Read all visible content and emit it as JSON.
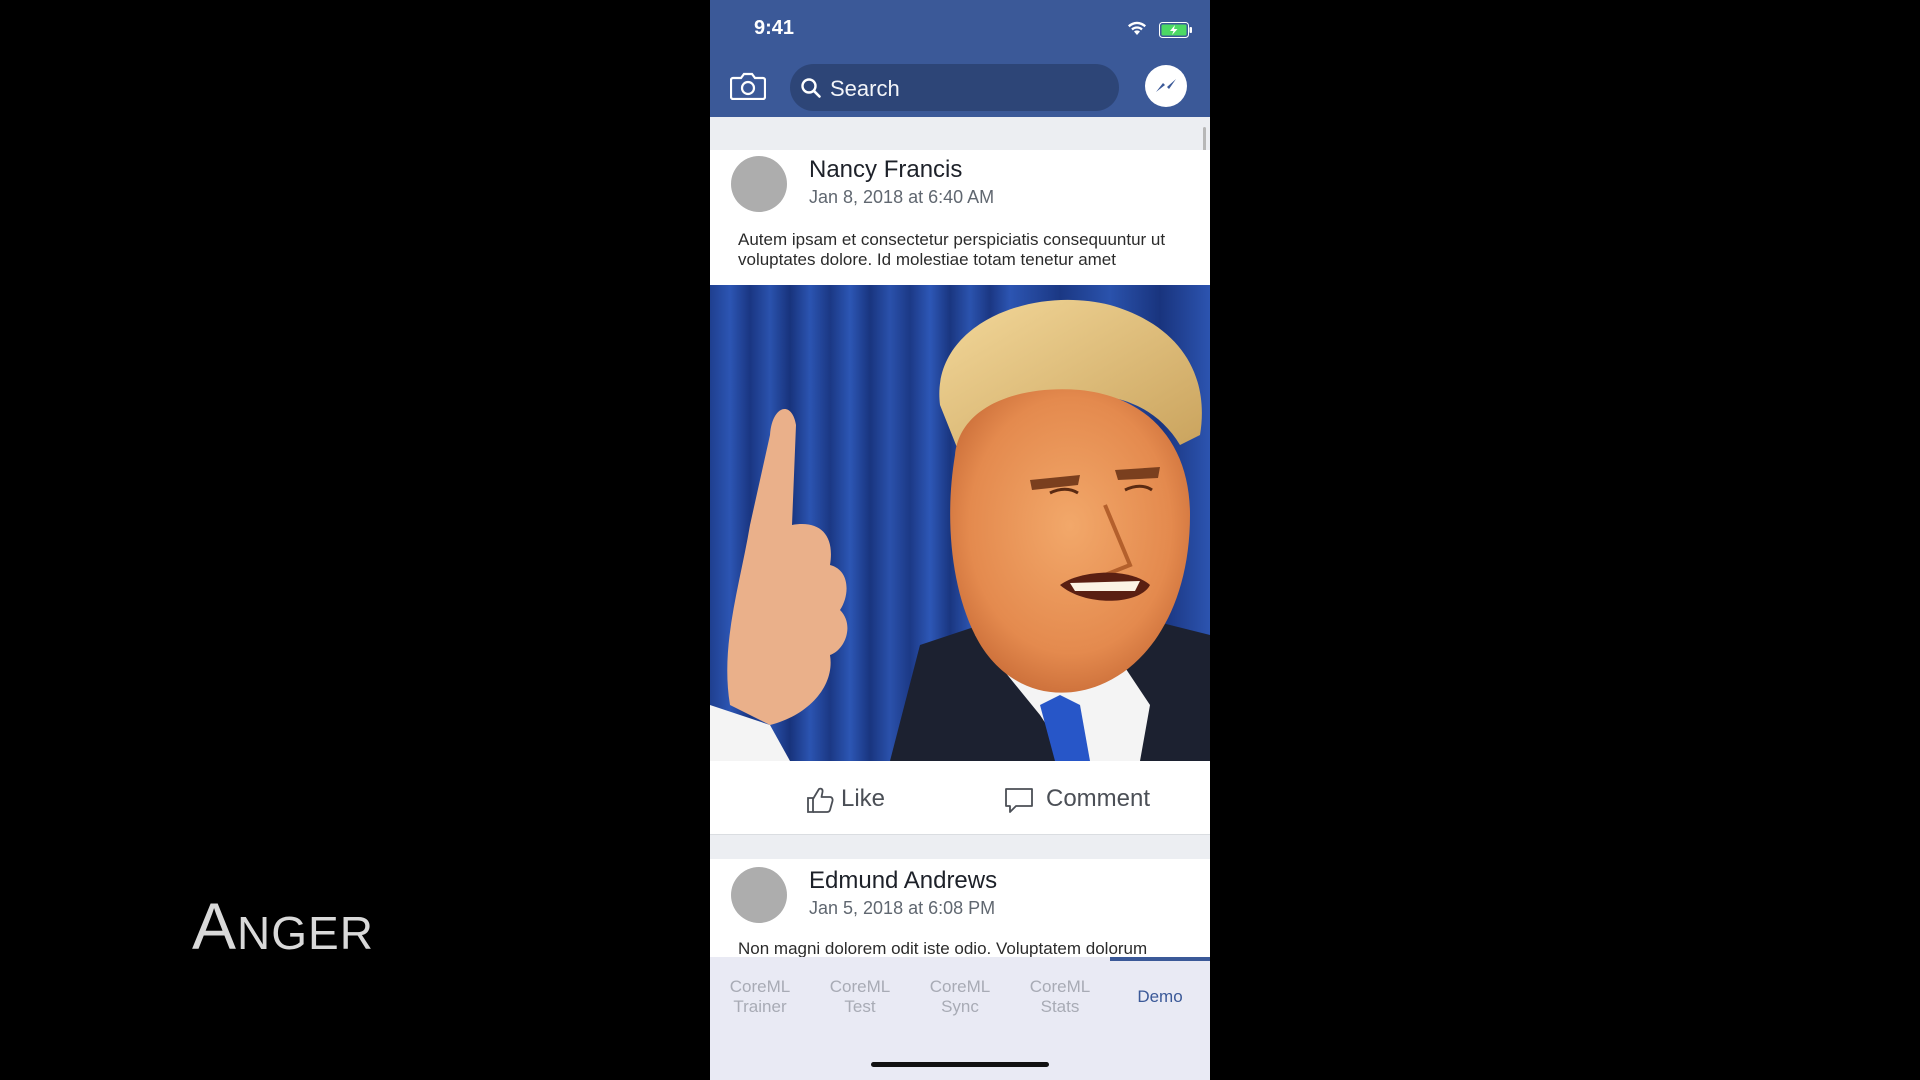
{
  "overlay": {
    "caption": "Anger"
  },
  "status_bar": {
    "time": "9:41"
  },
  "header": {
    "search_placeholder": "Search"
  },
  "feed": {
    "posts": [
      {
        "author": "Nancy Francis",
        "timestamp": "Jan 8, 2018 at 6:40 AM",
        "text": "Autem ipsam et consectetur perspiciatis consequuntur ut voluptates dolore. Id molestiae totam tenetur amet"
      },
      {
        "author": "Edmund Andrews",
        "timestamp": "Jan 5, 2018 at 6:08 PM",
        "text": "Non magni dolorem odit iste odio. Voluptatem dolorum"
      }
    ],
    "actions": {
      "like": "Like",
      "comment": "Comment"
    }
  },
  "tabbar": {
    "tabs": [
      {
        "label": "CoreML\nTrainer"
      },
      {
        "label": "CoreML\nTest"
      },
      {
        "label": "CoreML\nSync"
      },
      {
        "label": "CoreML\nStats"
      },
      {
        "label": "Demo"
      }
    ],
    "active_index": 4
  },
  "colors": {
    "brand": "#3b5998",
    "search_bg": "#2d4577",
    "tab_active": "#3b5998",
    "tab_inactive": "#a8abb5",
    "avatar": "#adadad"
  }
}
